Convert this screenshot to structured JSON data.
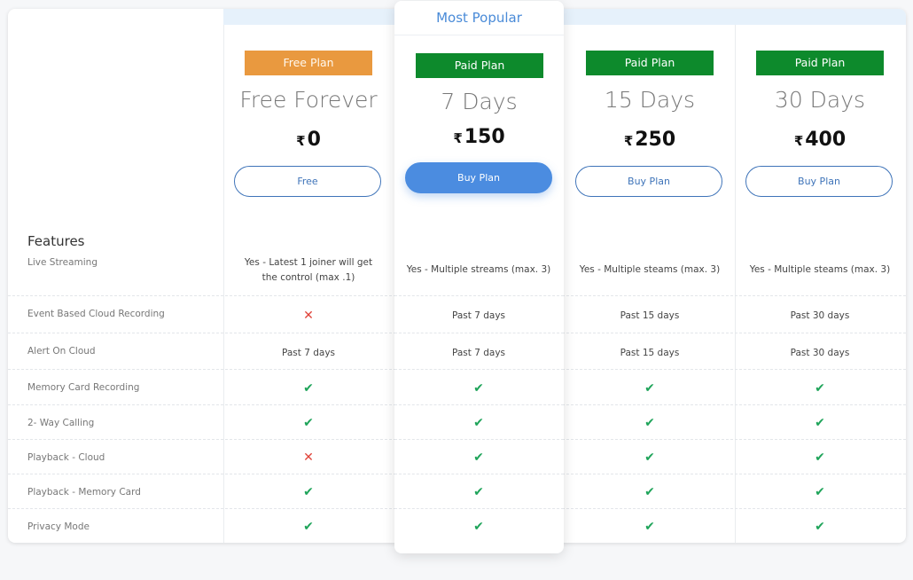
{
  "popular_label": "Most Popular",
  "features_title": "Features",
  "currency_symbol": "₹",
  "plans": [
    {
      "badge": "Free Plan",
      "name": "Free Forever",
      "price": "0",
      "button": "Free"
    },
    {
      "badge": "Paid Plan",
      "name": "7 Days",
      "price": "150",
      "button": "Buy Plan"
    },
    {
      "badge": "Paid Plan",
      "name": "15 Days",
      "price": "250",
      "button": "Buy Plan"
    },
    {
      "badge": "Paid Plan",
      "name": "30 Days",
      "price": "400",
      "button": "Buy Plan"
    }
  ],
  "rows": [
    {
      "label": "Live Streaming",
      "cells": [
        {
          "text": "Yes - Latest 1 joiner will get the control (max .1)"
        },
        {
          "text": "Yes - Multiple streams (max. 3)"
        },
        {
          "text": "Yes - Multiple steams (max. 3)"
        },
        {
          "text": "Yes - Multiple steams (max. 3)"
        }
      ]
    },
    {
      "label": "Event Based Cloud Recording",
      "cells": [
        {
          "icon": "cross-icon"
        },
        {
          "text": "Past 7 days"
        },
        {
          "text": "Past 15 days"
        },
        {
          "text": "Past 30 days"
        }
      ]
    },
    {
      "label": "Alert On Cloud",
      "cells": [
        {
          "text": "Past 7 days"
        },
        {
          "text": "Past 7 days"
        },
        {
          "text": "Past 15 days"
        },
        {
          "text": "Past 30 days"
        }
      ]
    },
    {
      "label": "Memory Card Recording",
      "cells": [
        {
          "icon": "check-icon"
        },
        {
          "icon": "check-icon"
        },
        {
          "icon": "check-icon"
        },
        {
          "icon": "check-icon"
        }
      ]
    },
    {
      "label": "2- Way Calling",
      "cells": [
        {
          "icon": "check-icon"
        },
        {
          "icon": "check-icon"
        },
        {
          "icon": "check-icon"
        },
        {
          "icon": "check-icon"
        }
      ]
    },
    {
      "label": "Playback - Cloud",
      "cells": [
        {
          "icon": "cross-icon"
        },
        {
          "icon": "check-icon"
        },
        {
          "icon": "check-icon"
        },
        {
          "icon": "check-icon"
        }
      ]
    },
    {
      "label": "Playback - Memory Card",
      "cells": [
        {
          "icon": "check-icon"
        },
        {
          "icon": "check-icon"
        },
        {
          "icon": "check-icon"
        },
        {
          "icon": "check-icon"
        }
      ]
    },
    {
      "label": "Privacy Mode",
      "cells": [
        {
          "icon": "check-icon"
        },
        {
          "icon": "check-icon"
        },
        {
          "icon": "check-icon"
        },
        {
          "icon": "check-icon"
        }
      ]
    }
  ],
  "colors": {
    "free_badge": "#e9993f",
    "paid_badge": "#0d8a2c",
    "buy_filled": "#4b8ce0",
    "check": "#1fa45a",
    "cross": "#e0443a",
    "popular_text": "#4a8bd8"
  }
}
